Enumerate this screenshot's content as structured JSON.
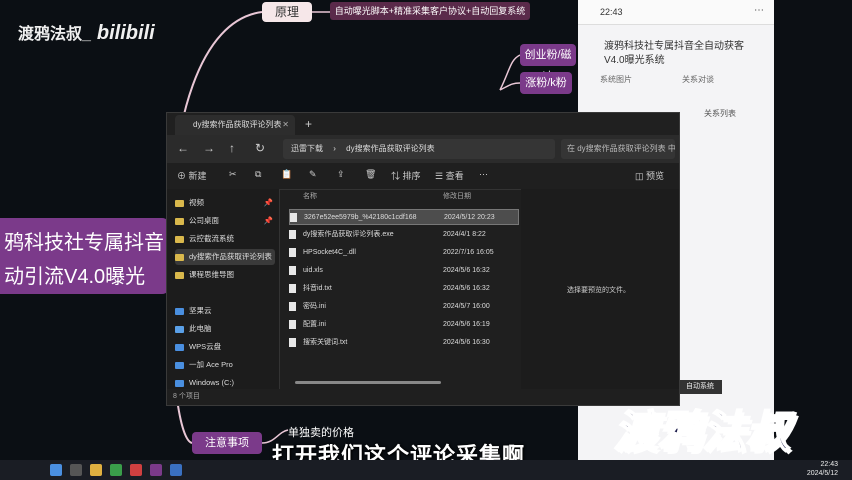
{
  "channel": {
    "name": "渡鸦法叔_",
    "platform": "bilibili"
  },
  "mindmap": {
    "principle": "原理",
    "auto_desc": "自动曝光脚本+精准采集客户协议+自动回复系统",
    "main_line1": "鸦科技社专属抖音",
    "main_line2": "动引流V4.0曝光",
    "right1": "创业粉/磁速",
    "right2": "涨粉/k粉",
    "note": "注意事项",
    "price": "单独卖的价格"
  },
  "doc": {
    "title": "渡鸦科技社专属抖音全自动获客V4.0曝光系统",
    "tab1": "系统图片",
    "tab2": "关系对谈",
    "row2": "关系列表",
    "time": "22:43",
    "bottom_label": "自动系统"
  },
  "explorer": {
    "tab_title": "dy搜索作品获取评论列表",
    "breadcrumb1": "迅雷下载",
    "breadcrumb2": "dy搜索作品获取评论列表",
    "search_placeholder": "在 dy搜索作品获取评论列表 中搜索",
    "toolbar": {
      "new": "新建",
      "sort": "排序",
      "view": "查看",
      "details": "预览"
    },
    "columns": {
      "name": "名称",
      "date": "修改日期"
    },
    "sidebar": [
      {
        "label": "视频",
        "pinned": true
      },
      {
        "label": "公司桌面",
        "pinned": true
      },
      {
        "label": "云控截流系统",
        "pinned": false
      },
      {
        "label": "dy搜索作品获取评论列表",
        "pinned": false
      },
      {
        "label": "课程思维导图",
        "pinned": false
      },
      {
        "label": "坚果云",
        "pinned": false
      },
      {
        "label": "此电脑",
        "pinned": false
      },
      {
        "label": "WPS云盘",
        "pinned": false
      },
      {
        "label": "一加 Ace Pro",
        "pinned": false
      },
      {
        "label": "Windows (C:)",
        "pinned": false
      }
    ],
    "files": [
      {
        "name": "3267e52ee5979b_%42180c1cdf168",
        "date": "2024/5/12 20:23"
      },
      {
        "name": "dy搜索作品获取评论列表.exe",
        "date": "2024/4/1 8:22"
      },
      {
        "name": "HPSocket4C_.dll",
        "date": "2022/7/16 16:05"
      },
      {
        "name": "uid.xls",
        "date": "2024/5/6 16:32"
      },
      {
        "name": "抖音id.txt",
        "date": "2024/5/6 16:32"
      },
      {
        "name": "密码.ini",
        "date": "2024/5/7 16:00"
      },
      {
        "name": "配置.ini",
        "date": "2024/5/6 16:19"
      },
      {
        "name": "搜索关键词.txt",
        "date": "2024/5/6 16:30"
      }
    ],
    "preview_msg": "选择要预览的文件。",
    "status": "8 个项目"
  },
  "subtitle": "打开我们这个评论采集啊",
  "watermark": "渡鸦法叔",
  "taskbar": {
    "time": "22:43",
    "date": "2024/5/12"
  },
  "colors": {
    "accent": "#7b3a8a",
    "window_bg": "#1f1f1f",
    "folder": "#d9b84c"
  }
}
